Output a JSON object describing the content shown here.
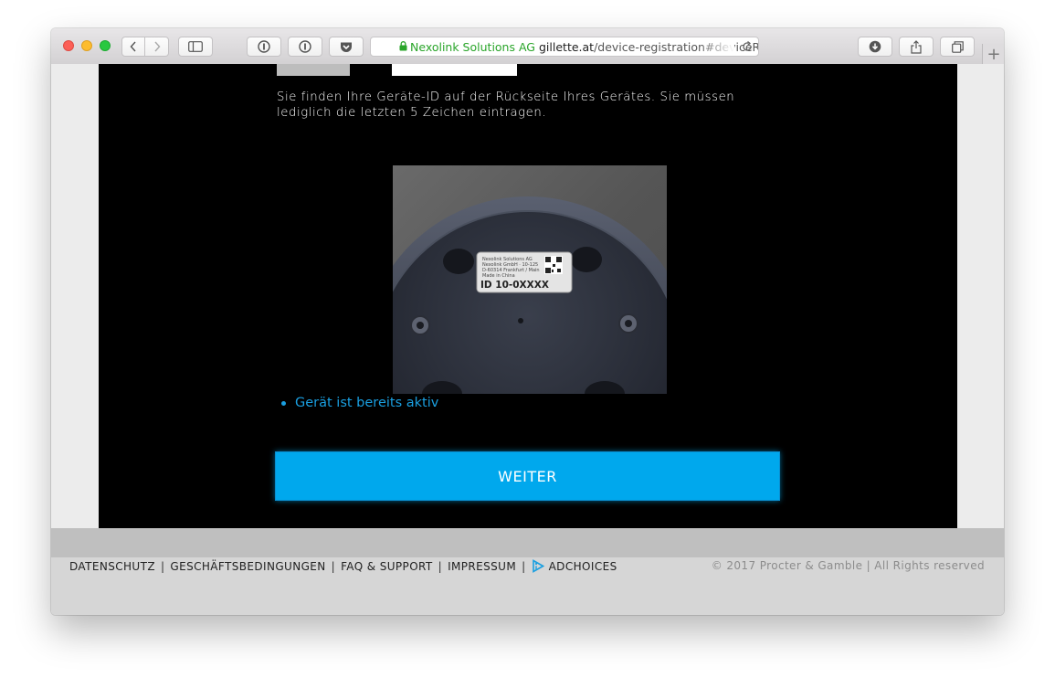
{
  "browser": {
    "address": {
      "secure_label": "Nexolink Solutions AG",
      "domain": "gillette.at",
      "path": "/device-registration#deviceRe"
    },
    "icons": {
      "back": "chevron-left-icon",
      "forward": "chevron-right-icon",
      "sidebar": "sidebar-icon",
      "password_manager": "1password-icon",
      "pocket": "pocket-icon",
      "lock": "lock-icon",
      "reload": "reload-icon",
      "downloads": "download-icon",
      "share": "share-icon",
      "tabs": "tabs-overview-icon",
      "new_tab": "plus-icon"
    }
  },
  "page": {
    "device_id_hint": "Sie finden Ihre Geräte-ID auf der Rückseite Ihres Gerätes. Sie müssen lediglich die letzten 5 Zeichen eintragen.",
    "device_image": {
      "label_lines": [
        "Nexolink Solutions AG",
        "Nexolink GmbH · 10-125",
        "D-60314 Frankfurt / Main",
        "Made in China"
      ],
      "id_text": "ID 10-0XXXX"
    },
    "status_items": [
      "Gerät ist bereits aktiv"
    ],
    "weiter_button": "WEITER",
    "colors": {
      "accent": "#00a8ed",
      "link": "#1a9fe0",
      "background": "#000000"
    }
  },
  "footer": {
    "links": [
      "DATENSCHUTZ",
      "GESCHÄFTSBEDINGUNGEN",
      "FAQ & SUPPORT",
      "IMPRESSUM"
    ],
    "separator": "|",
    "adchoices": "ADCHOICES",
    "copyright": "© 2017 Procter & Gamble | All Rights reserved"
  }
}
